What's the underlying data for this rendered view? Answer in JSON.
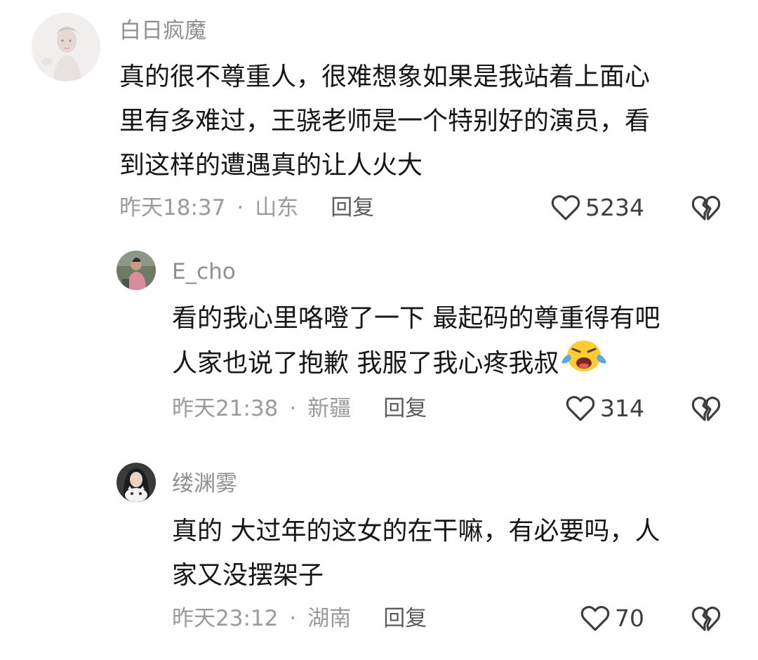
{
  "comments": [
    {
      "username": "白日疯魔",
      "lines": [
        "真的很不尊重人，很难想象如果是我站着上面心",
        "里有多难过，王骁老师是一个特别好的演员，看",
        "到这样的遭遇真的让人火大"
      ],
      "time": "昨天18:37",
      "dot": "·",
      "location": "山东",
      "reply_label": "回复",
      "likes": "5234"
    },
    {
      "username": "E_cho",
      "lines": [
        "看的我心里咯噔了一下 最起码的尊重得有吧",
        "人家也说了抱歉 我服了我心疼我叔"
      ],
      "emoji": "crying-face-emoji",
      "time": "昨天21:38",
      "dot": "·",
      "location": "新疆",
      "reply_label": "回复",
      "likes": "314"
    },
    {
      "username": "缕渊雾",
      "lines": [
        "真的 大过年的这女的在干嘛，有必要吗，人",
        "家又没摆架子"
      ],
      "time": "昨天23:12",
      "dot": "·",
      "location": "湖南",
      "reply_label": "回复",
      "likes": "70"
    }
  ],
  "icons": {
    "like": "heart-outline-icon",
    "dislike": "broken-heart-icon"
  },
  "colors": {
    "username": "#8f8f93",
    "body": "#161616",
    "meta": "#9a9a9e"
  }
}
